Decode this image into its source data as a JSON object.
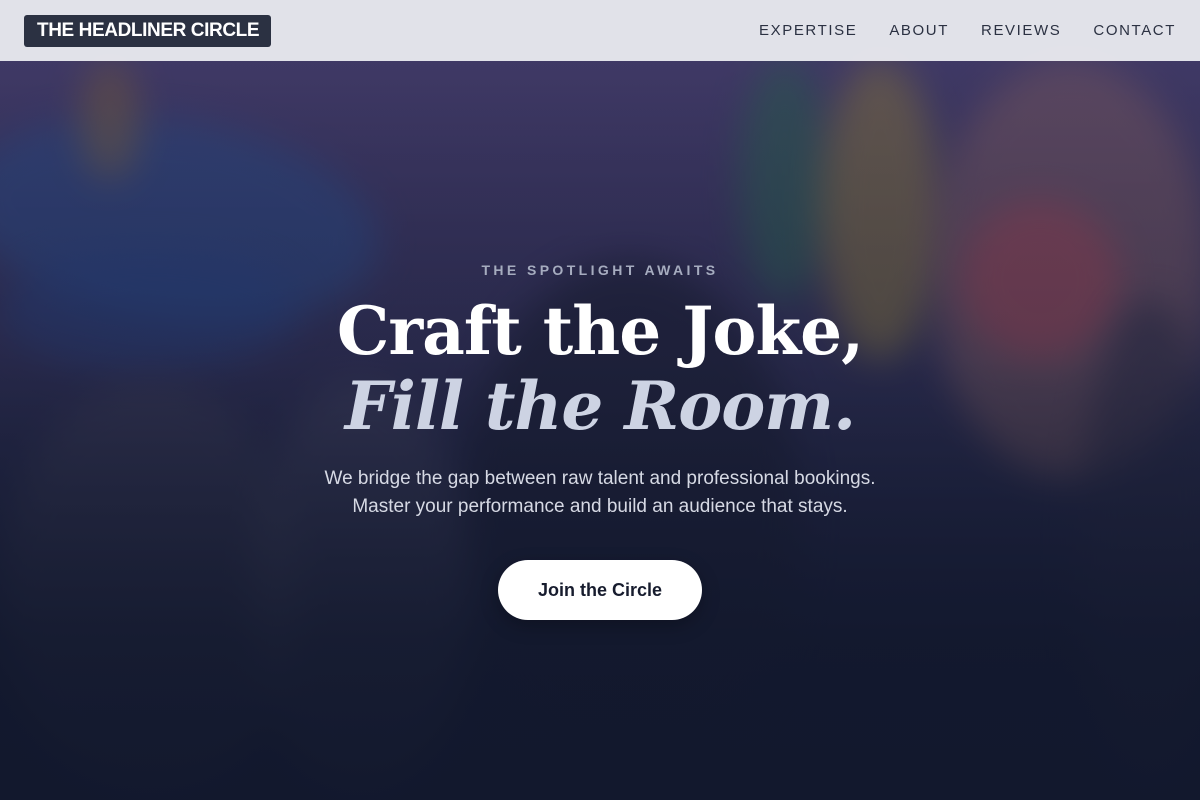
{
  "nav": {
    "logo": "THE HEADLINER CIRCLE",
    "links": [
      "EXPERTISE",
      "ABOUT",
      "REVIEWS",
      "CONTACT"
    ]
  },
  "hero": {
    "eyebrow": "THE SPOTLIGHT AWAITS",
    "headline_line1": "Craft the Joke,",
    "headline_line2": "Fill the Room.",
    "subtext_line1": "We bridge the gap between raw talent and professional bookings.",
    "subtext_line2": "Master your performance and build an audience that stays.",
    "cta_label": "Join the Circle"
  },
  "colors": {
    "navbar_bg": "#e8e9ee",
    "logo_bg": "#2b3142",
    "hero_dark": "#141a30",
    "eyebrow": "#a6acbf",
    "headline_italic": "#cdd3e3",
    "cta_bg": "#ffffff"
  }
}
